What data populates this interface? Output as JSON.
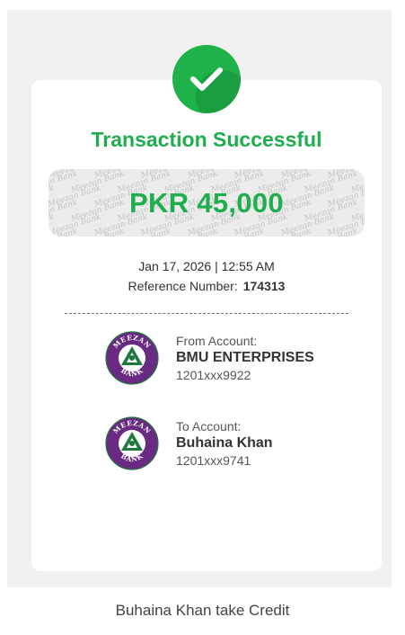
{
  "receipt": {
    "title": "Transaction Successful",
    "amount": "PKR 45,000",
    "watermark_text": "Meezan Bank",
    "datetime": "Jan 17, 2026 | 12:55 AM",
    "reference_label": "Reference Number:",
    "reference_value": "174313",
    "from": {
      "caption": "From Account:",
      "name": "BMU ENTERPRISES",
      "number": "1201xxx9922"
    },
    "to": {
      "caption": "To Account:",
      "name": "Buhaina Khan",
      "number": "1201xxx9741"
    },
    "bank_logo_text": "MEEZAN BANK"
  },
  "footer": {
    "caption": "Buhaina Khan take Credit"
  },
  "colors": {
    "success_green": "#1fae4d",
    "brand_purple": "#6a2a83",
    "brand_green": "#1e7a3c"
  },
  "icons": {
    "status": "check-circle-icon",
    "bank": "meezan-bank-logo-icon"
  }
}
